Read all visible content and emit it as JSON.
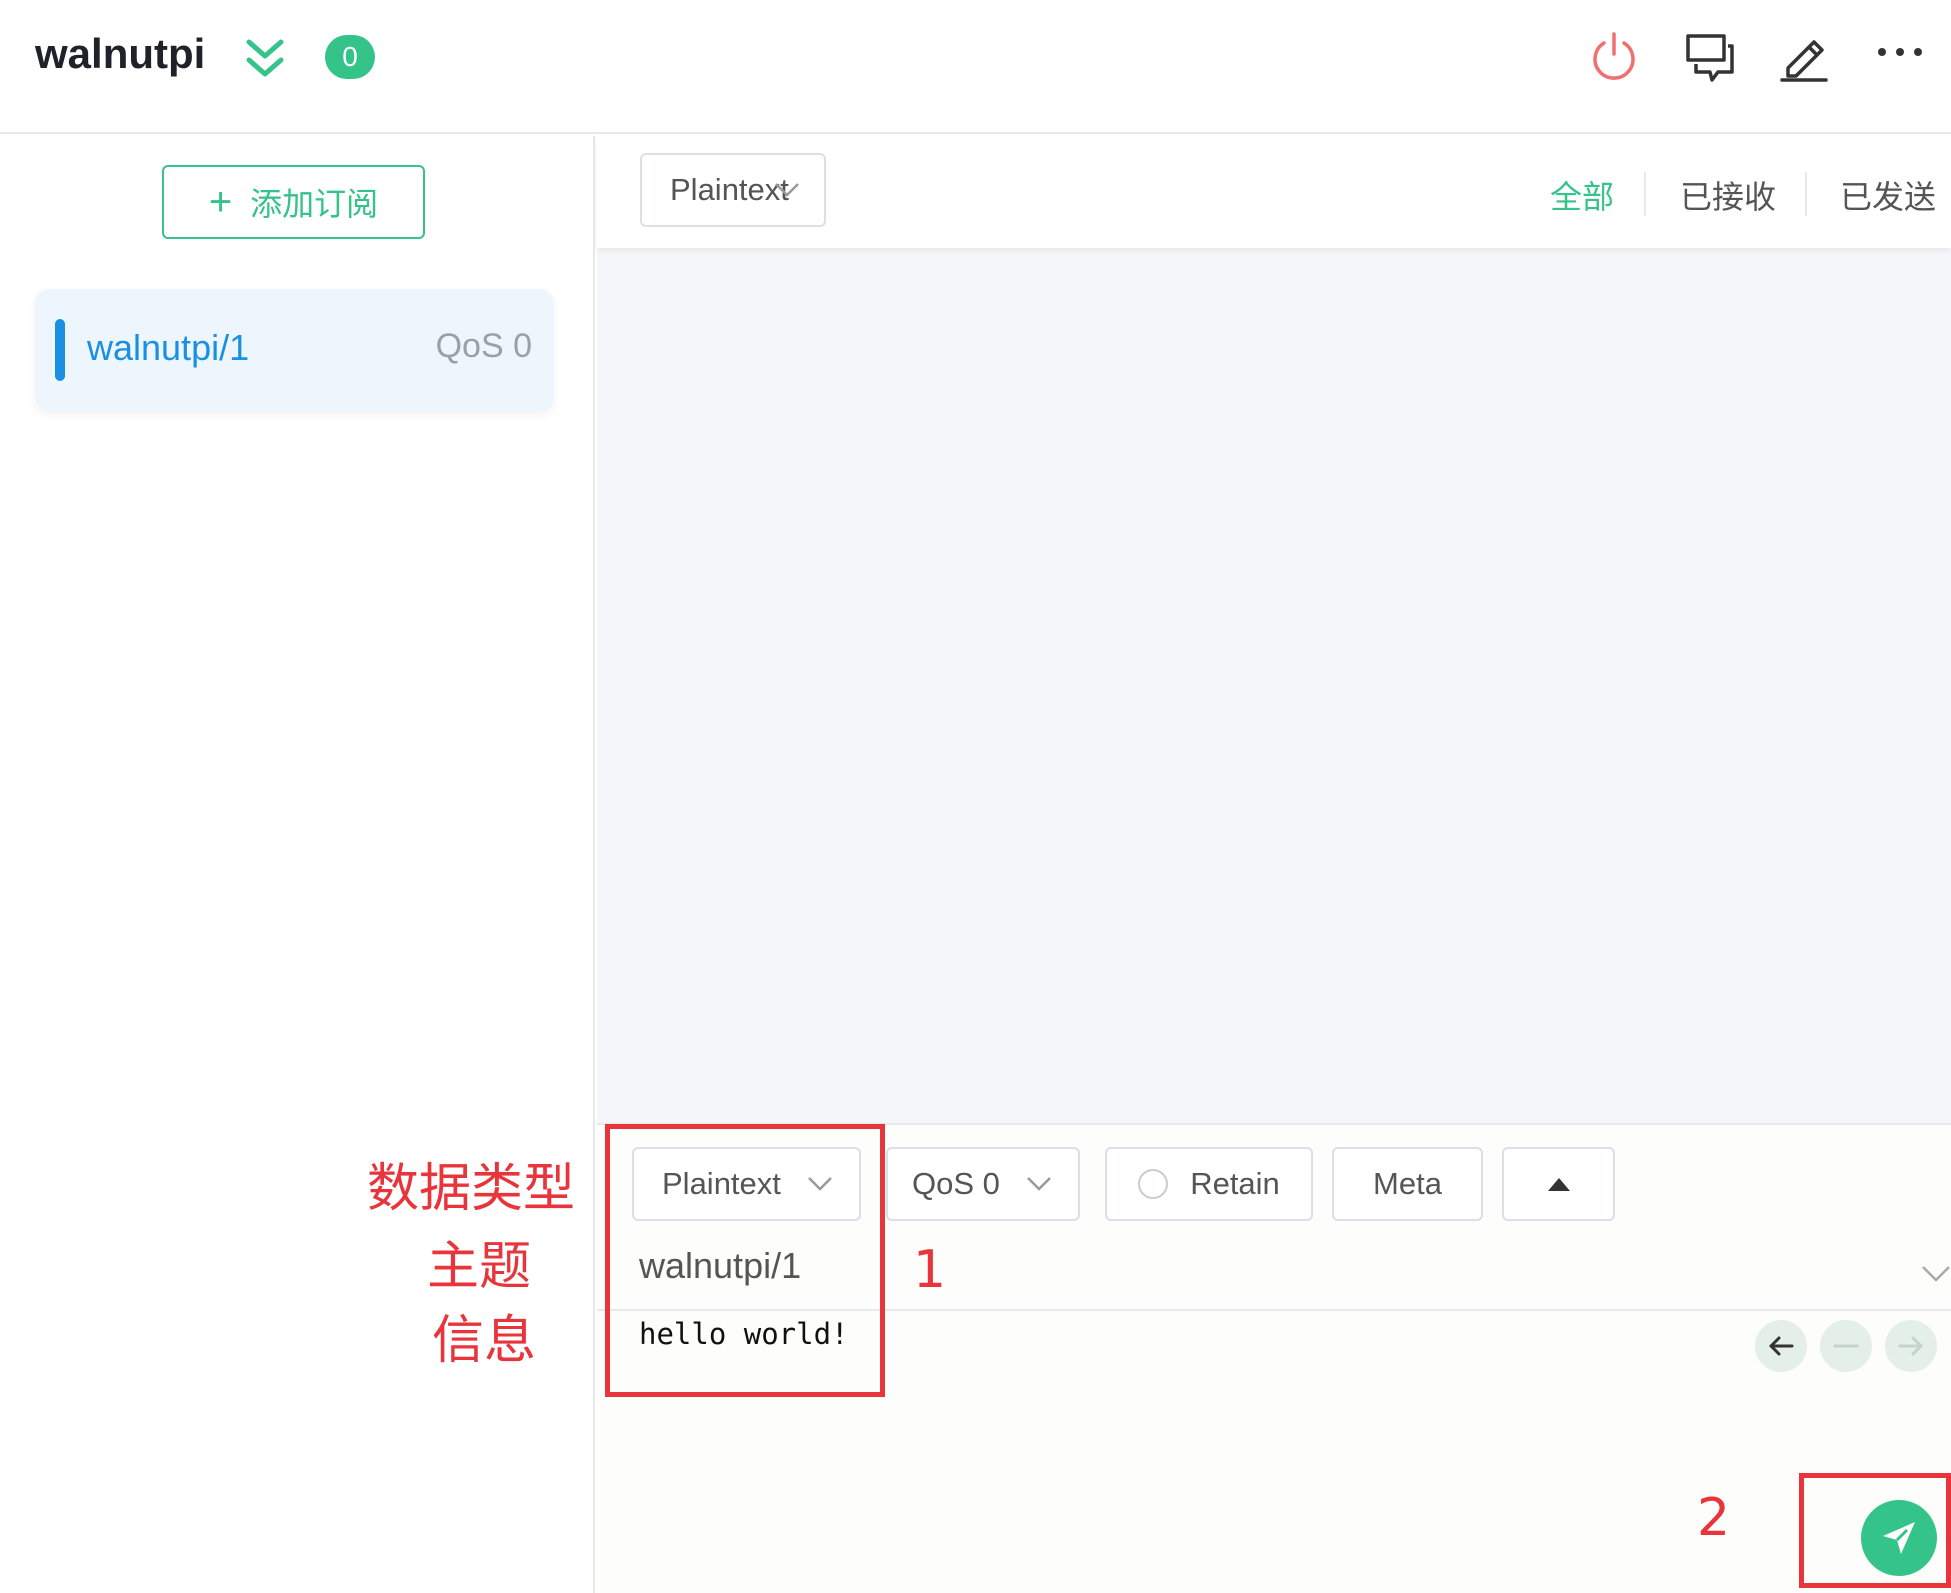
{
  "header": {
    "connection_name": "walnutpi",
    "unread_count": "0",
    "icons": [
      "collapse-icon",
      "power-icon",
      "chat-icon",
      "edit-icon",
      "more-icon"
    ]
  },
  "sidebar": {
    "add_subscription_label": "添加订阅",
    "subscriptions": [
      {
        "topic": "walnutpi/1",
        "qos": "QoS 0",
        "color": "#1a8fe3"
      }
    ]
  },
  "messages": {
    "payload_format": "Plaintext",
    "filters": [
      "全部",
      "已接收",
      "已发送"
    ],
    "active_filter": "全部"
  },
  "publish": {
    "payload_format": "Plaintext",
    "qos": "QoS 0",
    "retain_label": "Retain",
    "meta_label": "Meta",
    "topic": "walnutpi/1",
    "payload": "hello world!"
  },
  "annotations": {
    "labels": [
      "数据类型",
      "主题",
      "信息"
    ],
    "marker_1": "1",
    "marker_2": "2"
  },
  "colors": {
    "accent": "#34c388",
    "subscription": "#1a8fe3",
    "annotation": "#e8343b",
    "power": "#f07070"
  }
}
